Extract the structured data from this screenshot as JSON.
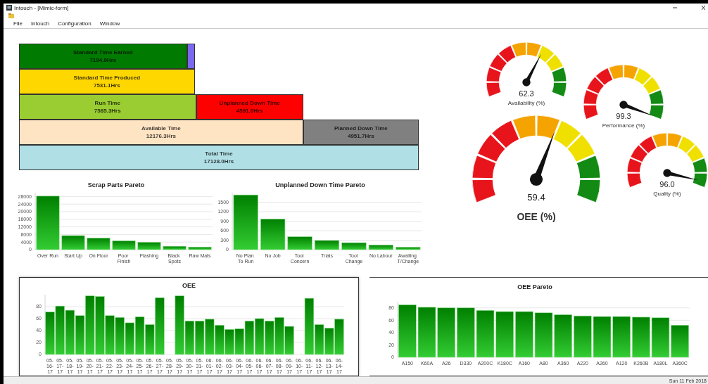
{
  "window": {
    "title": "Intouch - [Mimic-form]"
  },
  "menu": [
    "File",
    "Intouch",
    "Configuration",
    "Window"
  ],
  "waterfall": {
    "rows": [
      {
        "segments": [
          {
            "kind": "bar",
            "label": "Standard Time Earned",
            "value": "7194.9Hrs",
            "color": "#007a00"
          },
          {
            "kind": "gap",
            "color": "#7b68ee"
          }
        ]
      },
      {
        "segments": [
          {
            "kind": "bar",
            "label": "Standard Time Produced",
            "value": "7531.1Hrs",
            "color": "#ffd700"
          }
        ]
      },
      {
        "segments": [
          {
            "kind": "bar",
            "label": "Run Time",
            "value": "7585.3Hrs",
            "color": "#9acd32"
          },
          {
            "kind": "bar",
            "label": "Unplanned Down Time",
            "value": "4591.0Hrs",
            "color": "#ff0000"
          }
        ]
      },
      {
        "segments": [
          {
            "kind": "bar",
            "label": "Available Time",
            "value": "12176.3Hrs",
            "color": "#ffe4c4"
          },
          {
            "kind": "bar",
            "label": "Planned Down Time",
            "value": "4951.7Hrs",
            "color": "#808080"
          }
        ]
      },
      {
        "segments": [
          {
            "kind": "bar",
            "label": "Total Time",
            "value": "17128.0Hrs",
            "color": "#b0e0e6"
          }
        ]
      }
    ]
  },
  "charts": [
    {
      "chart_data": {
        "type": "bar",
        "title": "Scrap Parts Pareto",
        "grid": true,
        "ylim": [
          0,
          30000
        ],
        "categories": [
          "Over Run",
          "Start Up",
          "On Floor",
          "Poor Finish",
          "Flashing",
          "Black Spots",
          "Raw Mats"
        ],
        "values": [
          28200,
          7400,
          6100,
          4700,
          3900,
          1800,
          1400
        ],
        "yticks": [
          0,
          4000,
          8000,
          12000,
          16000,
          20000,
          24000,
          28000
        ]
      }
    },
    {
      "chart_data": {
        "type": "bar",
        "title": "Unplanned Down Time Pareto",
        "grid": true,
        "ylim": [
          0,
          1800
        ],
        "categories": [
          "No Plan To Run",
          "No Job",
          "Tool Concern",
          "Trials",
          "Tool Change",
          "No Labour",
          "Awaiting T/Change"
        ],
        "values": [
          1730,
          970,
          410,
          290,
          220,
          150,
          80
        ],
        "yticks": [
          0,
          300,
          600,
          900,
          1200,
          1500
        ]
      }
    },
    {
      "chart_data": {
        "type": "bar",
        "title": "OEE",
        "grid": true,
        "ylim": [
          0,
          100
        ],
        "categories": [
          "05-16-17",
          "05-17-17",
          "05-18-17",
          "05-19-17",
          "05-20-17",
          "05-21-17",
          "05-22-17",
          "05-23-17",
          "05-24-17",
          "05-25-17",
          "05-26-17",
          "05-27-17",
          "05-28-17",
          "05-29-17",
          "05-30-17",
          "05-31-17",
          "06-01-17",
          "06-02-17",
          "06-03-17",
          "06-04-17",
          "06-05-17",
          "06-06-17",
          "06-07-17",
          "06-08-17",
          "06-09-17",
          "06-10-17",
          "06-11-17",
          "06-12-17",
          "06-13-17",
          "06-14-17"
        ],
        "values": [
          71,
          81,
          74,
          65,
          98,
          97,
          65,
          62,
          53,
          63,
          50,
          95,
          null,
          98,
          56,
          56,
          59,
          49,
          42,
          43,
          56,
          60,
          56,
          62,
          47,
          null,
          94,
          50,
          44,
          59
        ],
        "yticks": [
          0,
          20,
          40,
          60,
          80
        ]
      }
    },
    {
      "chart_data": {
        "type": "bar",
        "title": "OEE Pareto",
        "grid": true,
        "ylim": [
          0,
          90
        ],
        "categories": [
          "A150",
          "K60A",
          "A26",
          "D330",
          "A200C",
          "K180C",
          "A160",
          "A80",
          "A360",
          "A220",
          "A260",
          "A120",
          "K260B",
          "A180L",
          "A360C"
        ],
        "values": [
          85,
          81,
          80,
          80,
          76,
          74,
          74,
          72,
          69,
          67,
          66,
          66,
          65,
          64,
          52
        ],
        "yticks": [
          0,
          20,
          40,
          60,
          80
        ]
      }
    }
  ],
  "gauges": [
    {
      "kind": "small",
      "value": "62.3",
      "label": "Availability (%)"
    },
    {
      "kind": "small",
      "value": "99.3",
      "label": "Performance (%)"
    },
    {
      "kind": "large",
      "value": "59.4",
      "label": "OEE (%)"
    },
    {
      "kind": "small",
      "value": "96.0",
      "label": "Quality (%)"
    }
  ],
  "status_bar": {
    "date": "Sun 11 Feb 2018"
  }
}
